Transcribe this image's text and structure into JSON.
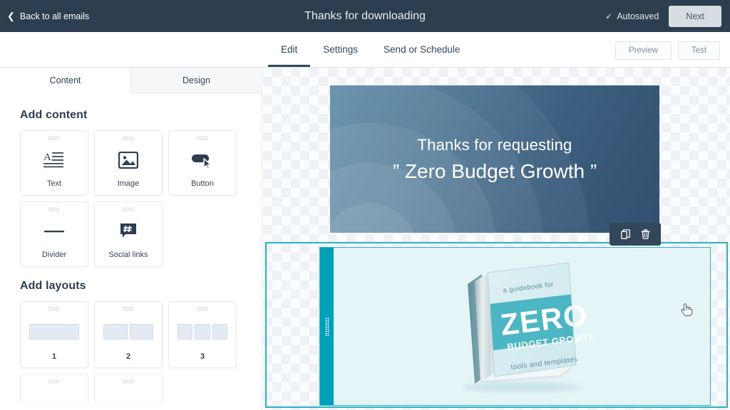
{
  "topbar": {
    "back_label": "Back to all emails",
    "back_icon": "chevron-left-icon",
    "title": "Thanks for downloading",
    "autosaved_label": "Autosaved",
    "autosaved_icon": "check-icon",
    "next_label": "Next"
  },
  "tabbar": {
    "tabs": [
      {
        "label": "Edit",
        "active": true
      },
      {
        "label": "Settings",
        "active": false
      },
      {
        "label": "Send or Schedule",
        "active": false
      }
    ],
    "preview_label": "Preview",
    "test_label": "Test"
  },
  "sidebar": {
    "tabs": [
      {
        "label": "Content",
        "active": true
      },
      {
        "label": "Design",
        "active": false
      }
    ],
    "add_content_title": "Add content",
    "content_modules": [
      {
        "label": "Text",
        "icon": "text-icon"
      },
      {
        "label": "Image",
        "icon": "image-icon"
      },
      {
        "label": "Button",
        "icon": "button-icon"
      },
      {
        "label": "Divider",
        "icon": "divider-icon"
      },
      {
        "label": "Social links",
        "icon": "social-links-icon"
      }
    ],
    "add_layouts_title": "Add layouts",
    "layouts": [
      {
        "label": "1",
        "columns": 1
      },
      {
        "label": "2",
        "columns": 2
      },
      {
        "label": "3",
        "columns": 3
      }
    ]
  },
  "canvas": {
    "banner": {
      "line1": "Thanks for requesting",
      "line2": "” Zero Budget Growth ”"
    },
    "selected_module": {
      "toolbar": [
        {
          "name": "duplicate-icon",
          "label": "Duplicate"
        },
        {
          "name": "trash-icon",
          "label": "Delete"
        }
      ],
      "drag_handle_label": "Drag module",
      "book": {
        "top_text": "a guidebook for",
        "title": "ZERO",
        "subtitle": "BUDGET GROWTH",
        "bottom_text": "tools and templates"
      }
    },
    "cursor": "pointing-hand-cursor"
  },
  "colors": {
    "topbar_bg": "#2d3e50",
    "accent_teal": "#00a0b8",
    "selection_border": "#2ab2c6",
    "module_bg": "#e5f5f7",
    "banner_blue": "#4a7492",
    "text_dark": "#33475b"
  }
}
